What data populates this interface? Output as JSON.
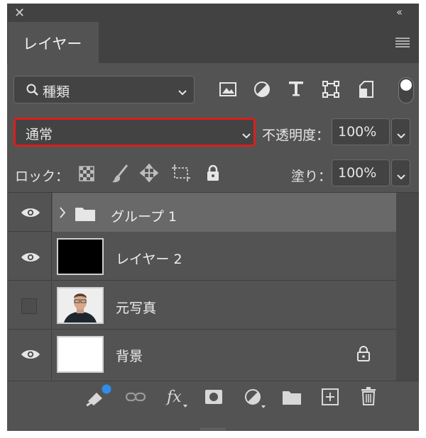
{
  "window": {
    "close_label": "✕",
    "collapse_label": "‹‹"
  },
  "tab": {
    "label": "レイヤー"
  },
  "filter": {
    "icon": "search-icon",
    "label": "種類",
    "chevron": "⌄"
  },
  "blend": {
    "value": "通常",
    "chevron": "⌄",
    "highlight_color": "#d9201f"
  },
  "opacity": {
    "label": "不透明度：",
    "value": "100%"
  },
  "lock": {
    "label": "ロック："
  },
  "fill": {
    "label": "塗り：",
    "value": "100%"
  },
  "layers": [
    {
      "name": "グループ 1",
      "visible": true,
      "type": "group"
    },
    {
      "name": "レイヤー 2",
      "visible": true,
      "type": "layer"
    },
    {
      "name": "元写真",
      "visible": false,
      "type": "photo"
    },
    {
      "name": "背景",
      "visible": true,
      "type": "background",
      "locked": true
    }
  ],
  "colors": {
    "accent_dot": "#2f8ee8",
    "panel_bg": "#535353",
    "header_bg": "#424242"
  }
}
